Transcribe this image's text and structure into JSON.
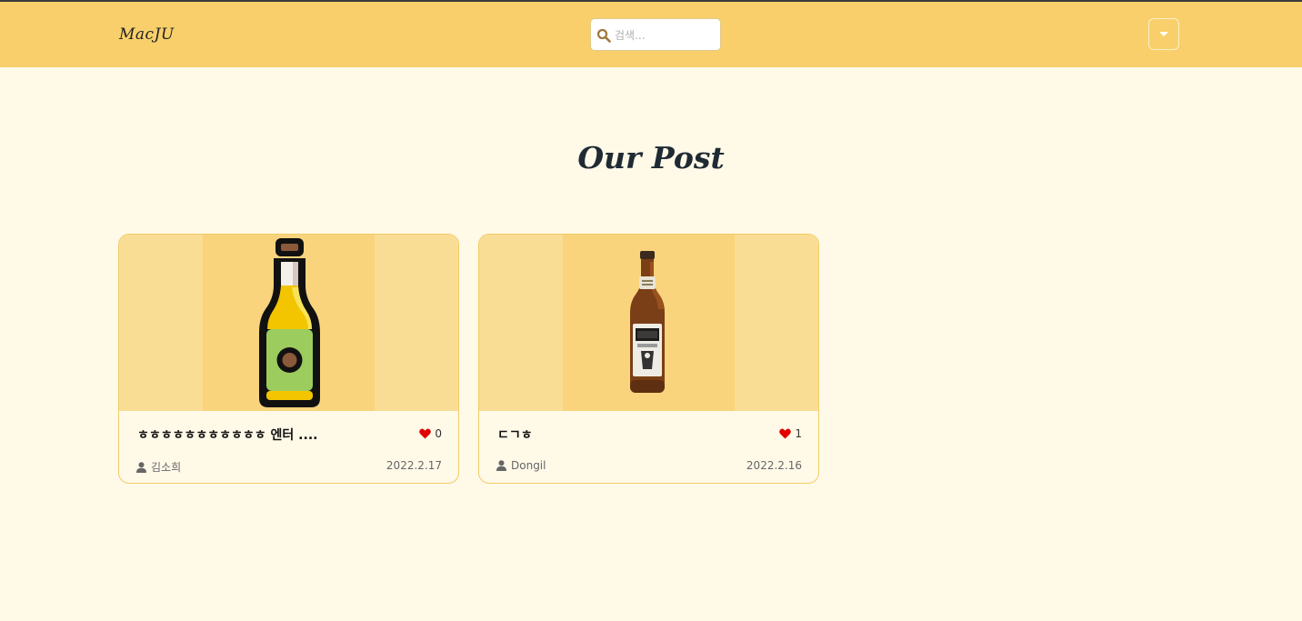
{
  "nav": {
    "logo": "MacJU",
    "search_placeholder": "검색..."
  },
  "main": {
    "heading": "Our Post"
  },
  "posts": [
    {
      "title": "ㅎㅎㅎㅎㅎㅎㅎㅎㅎㅎㅎ 엔터 ....",
      "likes": "0",
      "author": "김소희",
      "date": "2022.2.17",
      "image_icon": "beer-bottle-illustration"
    },
    {
      "title": "ㄷㄱㅎ",
      "likes": "1",
      "author": "Dongil",
      "date": "2022.2.16",
      "image_icon": "beer-bottle-photo"
    }
  ],
  "colors": {
    "navbar": "#f8cf6a",
    "page_bg": "#fff9e8",
    "card_border": "#f1cc65",
    "heart": "#e00000"
  }
}
